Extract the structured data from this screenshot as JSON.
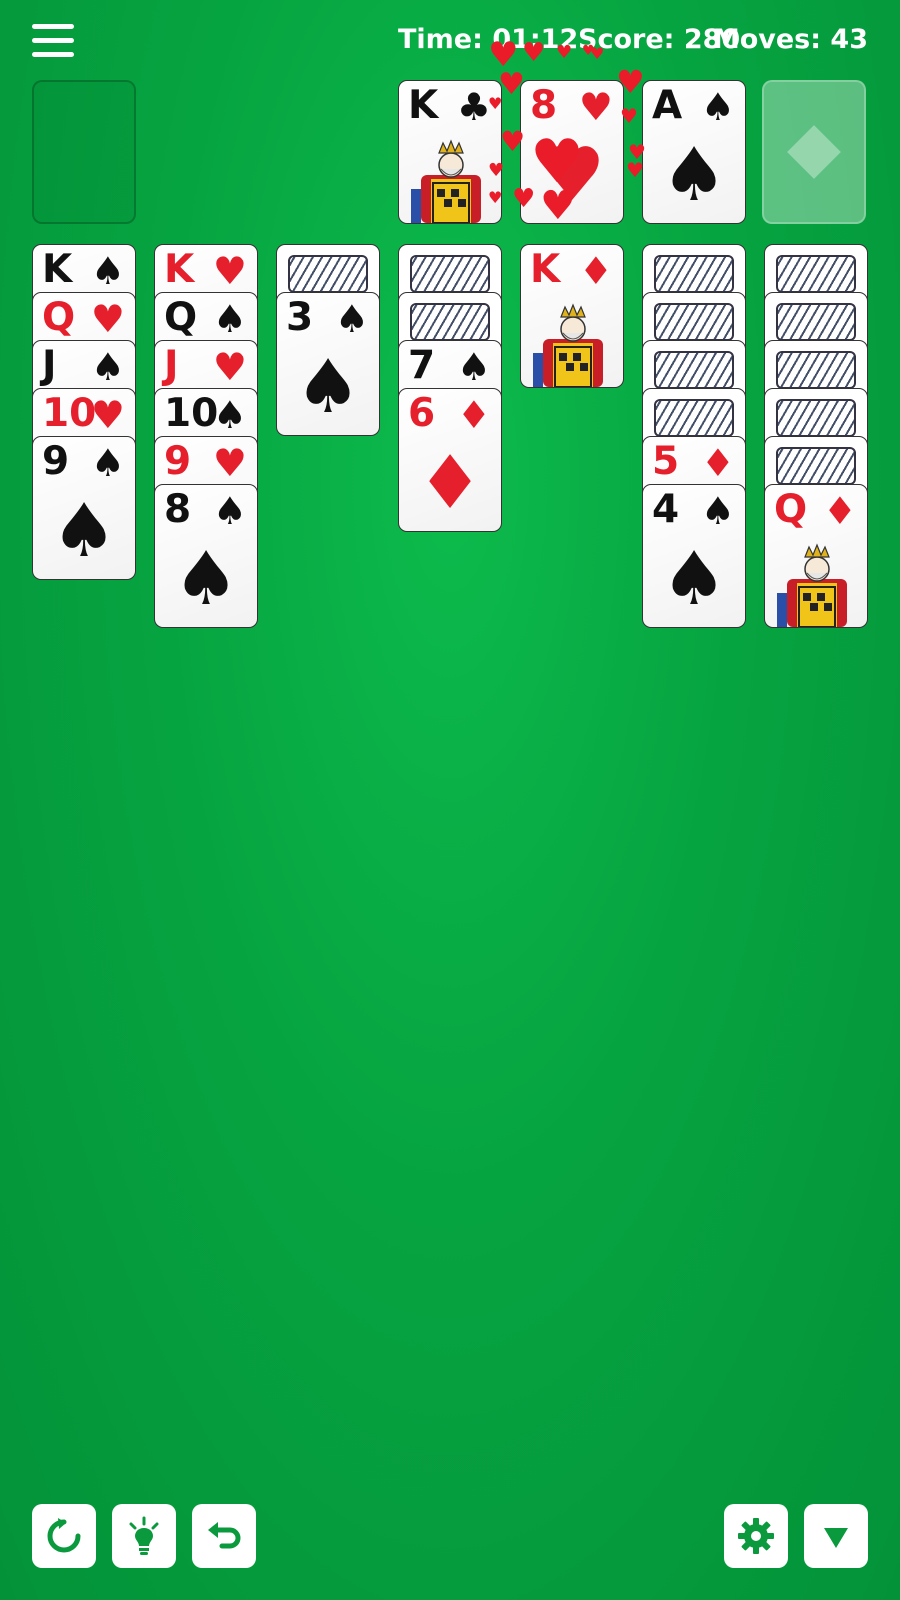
{
  "status": {
    "time_label": "Time: 01:12",
    "score_label": "Score: 280",
    "moves_label": "Moves: 43"
  },
  "foundations": [
    {
      "rank": "K",
      "suit": "♣",
      "color": "black"
    },
    {
      "rank": "8",
      "suit": "♥",
      "color": "red"
    },
    {
      "rank": "A",
      "suit": "♠",
      "color": "black"
    },
    {
      "empty": true,
      "suit_hint": "♦"
    }
  ],
  "tableau": [
    {
      "facedown": 0,
      "cards": [
        {
          "rank": "K",
          "suit": "♠",
          "color": "black"
        },
        {
          "rank": "Q",
          "suit": "♥",
          "color": "red"
        },
        {
          "rank": "J",
          "suit": "♠",
          "color": "black"
        },
        {
          "rank": "10",
          "suit": "♥",
          "color": "red"
        },
        {
          "rank": "9",
          "suit": "♠",
          "color": "black"
        }
      ]
    },
    {
      "facedown": 0,
      "cards": [
        {
          "rank": "K",
          "suit": "♥",
          "color": "red"
        },
        {
          "rank": "Q",
          "suit": "♠",
          "color": "black"
        },
        {
          "rank": "J",
          "suit": "♥",
          "color": "red"
        },
        {
          "rank": "10",
          "suit": "♠",
          "color": "black"
        },
        {
          "rank": "9",
          "suit": "♥",
          "color": "red"
        },
        {
          "rank": "8",
          "suit": "♠",
          "color": "black"
        }
      ]
    },
    {
      "facedown": 1,
      "cards": [
        {
          "rank": "3",
          "suit": "♠",
          "color": "black"
        }
      ]
    },
    {
      "facedown": 2,
      "cards": [
        {
          "rank": "7",
          "suit": "♠",
          "color": "black"
        },
        {
          "rank": "6",
          "suit": "♦",
          "color": "red"
        }
      ]
    },
    {
      "facedown": 0,
      "cards": [
        {
          "rank": "K",
          "suit": "♦",
          "color": "red"
        }
      ]
    },
    {
      "facedown": 4,
      "cards": [
        {
          "rank": "5",
          "suit": "♦",
          "color": "red"
        },
        {
          "rank": "4",
          "suit": "♠",
          "color": "black"
        }
      ]
    },
    {
      "facedown": 5,
      "cards": [
        {
          "rank": "Q",
          "suit": "♦",
          "color": "red"
        }
      ]
    }
  ],
  "toolbar": {
    "left": [
      "restart-icon",
      "hint-lightbulb-icon",
      "undo-icon"
    ],
    "right": [
      "settings-gear-icon",
      "collapse-triangle-icon"
    ]
  },
  "colors": {
    "felt": "#06a441",
    "red_suit": "#e51f2b",
    "black_suit": "#111111",
    "button_icon": "#0a9a3d"
  }
}
